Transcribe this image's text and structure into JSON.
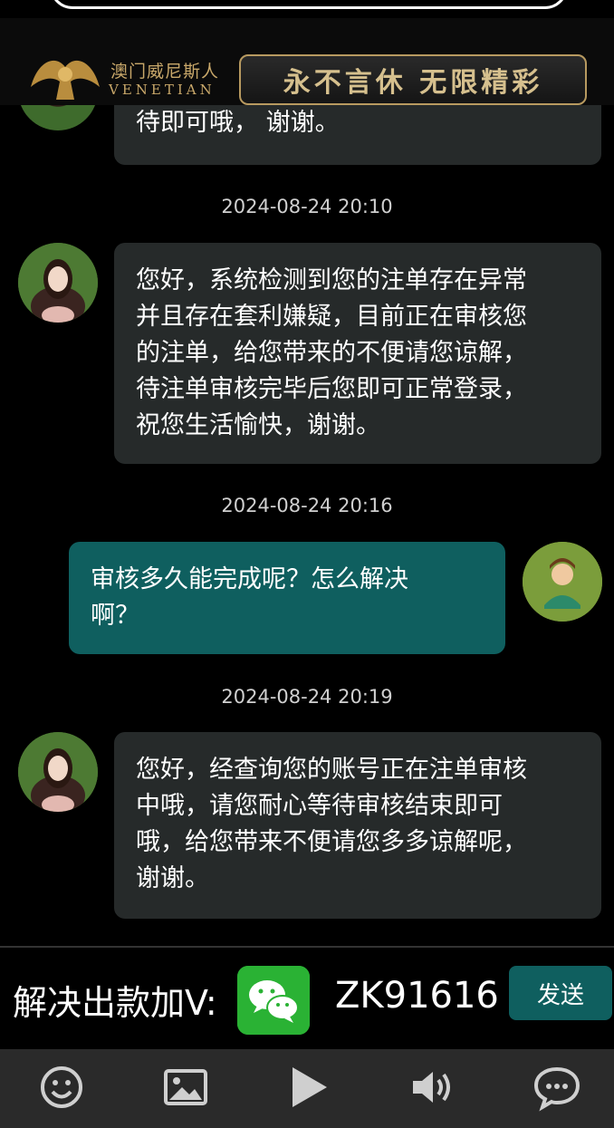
{
  "header": {
    "logo_cn": "澳门威尼斯人",
    "logo_en": "VENETIAN",
    "slogan": "永不言休  无限精彩",
    "logo_icon": "winged-lion-logo-icon"
  },
  "messages": {
    "m0": {
      "line1": "待即可哦， 谢谢。"
    },
    "ts1": "2024-08-24 20:10",
    "m1": {
      "lines": [
        "您好，系统检测到您的注单存在异常",
        "并且存在套利嫌疑，目前正在审核您",
        "的注单，给您带来的不便请您谅解，",
        "待注单审核完毕后您即可正常登录，",
        "祝您生活愉快，谢谢。"
      ]
    },
    "ts2": "2024-08-24 20:16",
    "m2": {
      "lines": [
        "审核多久能完成呢？怎么解决",
        "啊？"
      ]
    },
    "ts3": "2024-08-24 20:19",
    "m3": {
      "lines": [
        "您好，经查询您的账号正在注单审核",
        "中哦，请您耐心等待审核结束即可",
        "哦，给您带来不便请您多多谅解呢，",
        "谢谢。"
      ]
    }
  },
  "bottom": {
    "promo": "解决出款加V:",
    "wechat_icon": "wechat-icon",
    "wechat_id": "ZK91616",
    "send": "发送"
  },
  "toolbar": {
    "icons": [
      "emoji-icon",
      "image-icon",
      "play-icon",
      "volume-icon",
      "chat-bubble-icon"
    ]
  },
  "colors": {
    "incoming_bubble": "#262a2a",
    "outgoing_bubble": "#0f5f5f",
    "accent_gold": "#c9a86a",
    "wechat_green": "#2ab234"
  }
}
